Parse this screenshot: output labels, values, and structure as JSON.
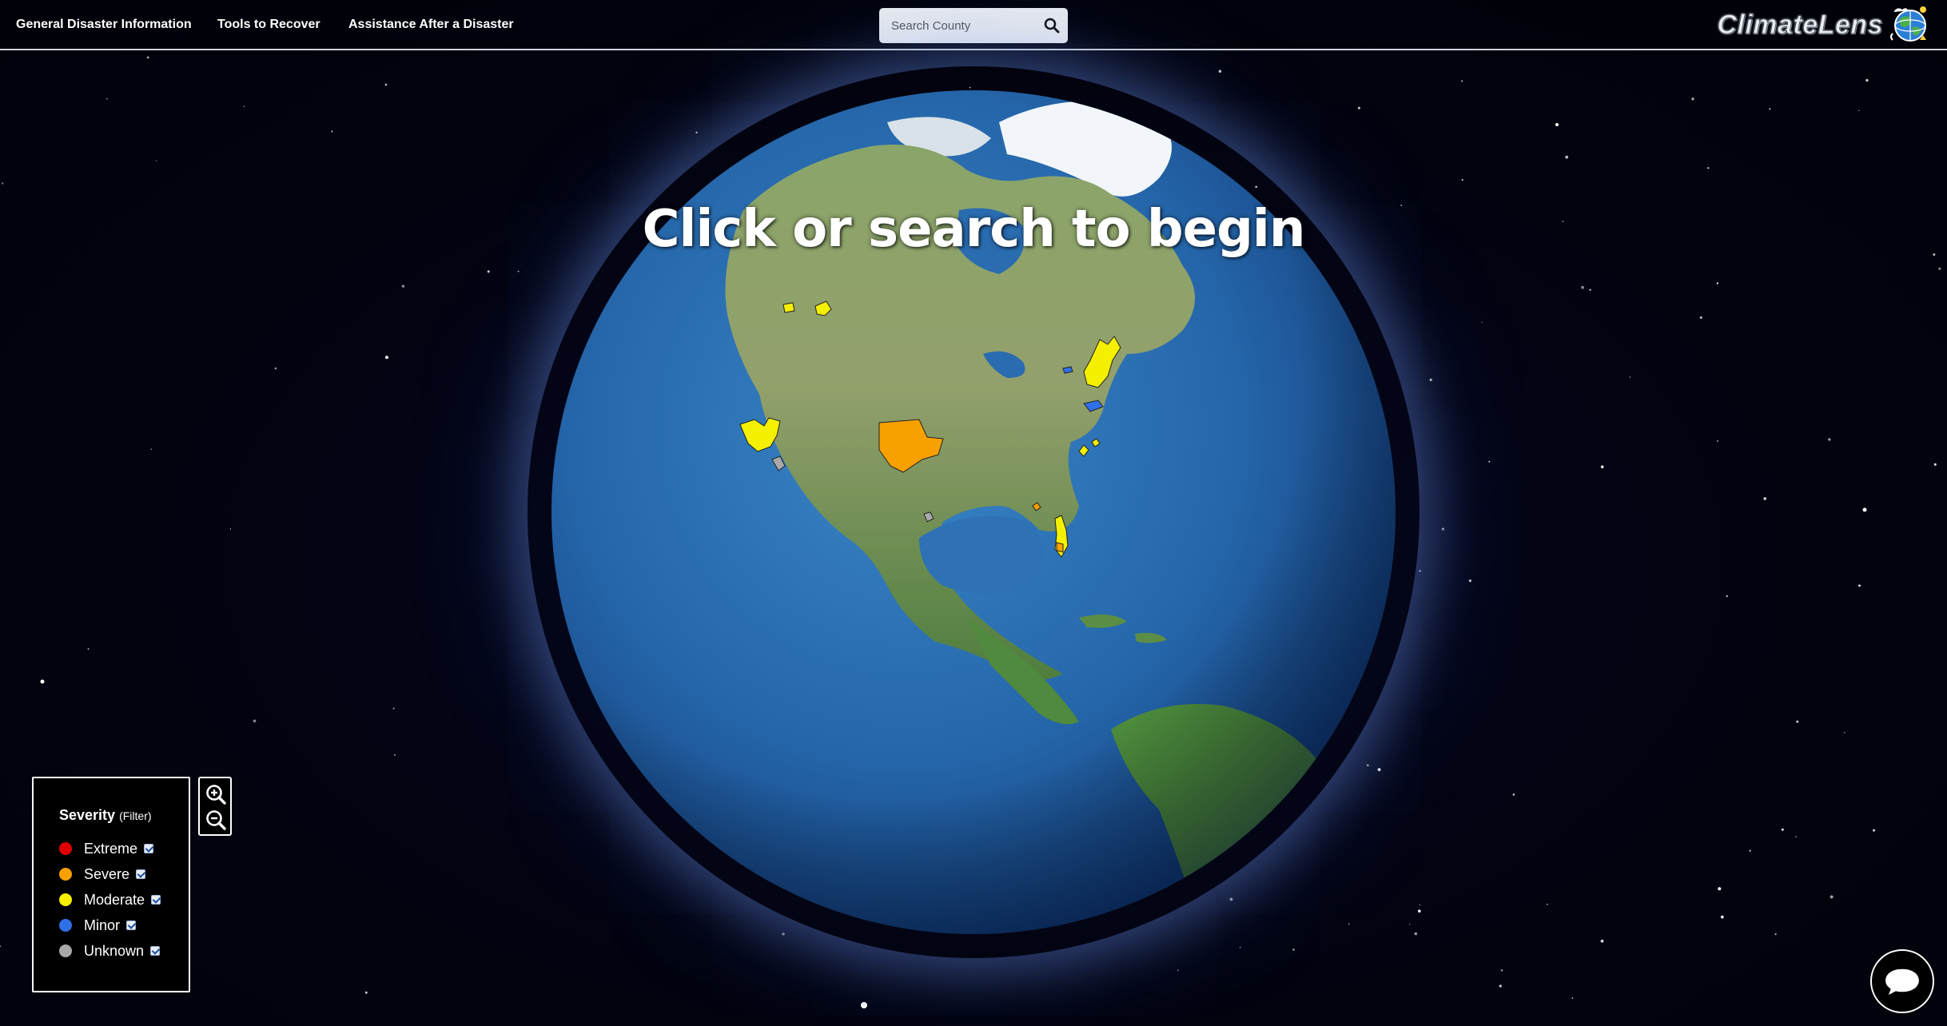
{
  "nav": {
    "items": [
      {
        "label": "General Disaster Information"
      },
      {
        "label": "Tools to Recover"
      },
      {
        "label": "Assistance After a Disaster"
      }
    ]
  },
  "search": {
    "placeholder": "Search County",
    "value": ""
  },
  "brand": {
    "name": "ClimateLens"
  },
  "headline": "Click or search to begin",
  "legend": {
    "title": "Severity",
    "subtitle": "(Filter)",
    "items": [
      {
        "label": "Extreme",
        "color": "#e00000",
        "checked": true
      },
      {
        "label": "Severe",
        "color": "#f7a000",
        "checked": true
      },
      {
        "label": "Moderate",
        "color": "#f5f000",
        "checked": true
      },
      {
        "label": "Minor",
        "color": "#2f6fe8",
        "checked": true
      },
      {
        "label": "Unknown",
        "color": "#a9a9a9",
        "checked": true
      }
    ]
  },
  "zoom": {
    "in_icon": "zoom-in-icon",
    "out_icon": "zoom-out-icon"
  },
  "chat": {
    "icon": "chat-bubble-icon"
  },
  "colors": {
    "ocean": "#2b6fb3",
    "land": "#6f9a52",
    "severe": "#f7a000",
    "moderate": "#f5f000",
    "minor": "#2f6fe8",
    "unknown": "#a9a9a9"
  }
}
